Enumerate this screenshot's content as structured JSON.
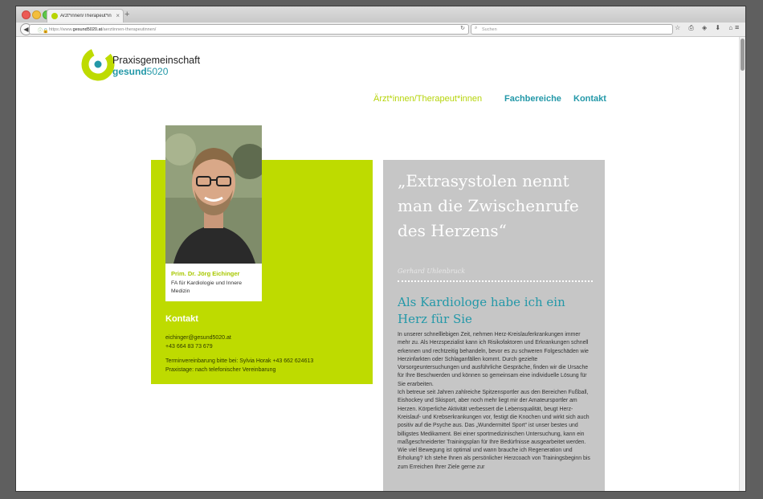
{
  "browser": {
    "tab_title": "Ärzt*innen/Therapeut*inn...",
    "tab_close": "×",
    "new_tab": "+",
    "url_prefix": "https://www.",
    "url_host": "gesund5020.at",
    "url_path": "/aerztinnen-therapeutinnen/",
    "search_placeholder": "Suchen",
    "toolbar_icons": "☆ ⎙ ◈ ⬇ ⌂",
    "menu_icon": "≡"
  },
  "site": {
    "logo_line1": "Praxisgemeinschaft",
    "logo_line2_bold": "gesund",
    "logo_line2_num": "5020",
    "nav": [
      "Ärzt*innen/Therapeut*innen",
      "Fachbereiche",
      "Kontakt"
    ]
  },
  "doctor": {
    "name": "Prim. Dr. Jörg Eichinger",
    "role": "FA für Kardiologie und Innere Medizin",
    "contact_heading": "Kontakt",
    "email": "eichinger@gesund5020.at",
    "phone": "+43 664 83 73 679",
    "appointment": "Terminvereinbarung bitte bei: Sylvia Horak +43 662 624613",
    "practice_days": "Praxistage: nach telefonischer Vereinbarung"
  },
  "article": {
    "quote": "„Extrasystolen nennt man die Zwischenrufe des Herzens“",
    "quote_author": "Gerhard Uhlenbruck",
    "heading": "Als Kardiologe habe ich ein Herz für Sie",
    "paragraph1": "In unserer schnelllebigen Zeit, nehmen Herz-Kreislauferkrankungen immer mehr zu. Als Herzspezialist kann ich Risikofaktoren und Erkrankungen schnell erkennen und rechtzeitig behandeln, bevor es zu schweren Folgeschäden wie Herzinfarkten oder Schlaganfällen kommt. Durch gezielte Vorsorgeuntersuchungen und ausführliche Gespräche, finden wir die Ursache für Ihre Beschwerden und können so gemeinsam eine individuelle Lösung für Sie erarbeiten.",
    "paragraph2": "Ich betreue seit Jahren zahlreiche Spitzensportler aus den Bereichen Fußball, Eishockey und Skisport, aber noch mehr liegt mir der Amateursportler am Herzen. Körperliche Aktivität verbessert die Lebensqualität, beugt Herz-Kreislauf- und Krebserkrankungen vor, festigt die Knochen und wirkt sich auch positiv auf die Psyche aus. Das „Wundermittel Sport“ ist unser bestes und billigstes Medikament. Bei einer sportmedizinischen Untersuchung, kann ein maßgeschneiderter Trainingsplan für Ihre Bedürfnisse ausgearbeitet werden. Wie viel Bewegung ist optimal und wann brauche ich Regeneration und Erholung? Ich stehe Ihnen als persönlicher Herzcoach von Trainingsbeginn bis zum Erreichen Ihrer Ziele gerne zur"
  },
  "colors": {
    "brand_green": "#bedb00",
    "brand_teal": "#2398a8",
    "panel_grey": "#c6c6c6"
  }
}
